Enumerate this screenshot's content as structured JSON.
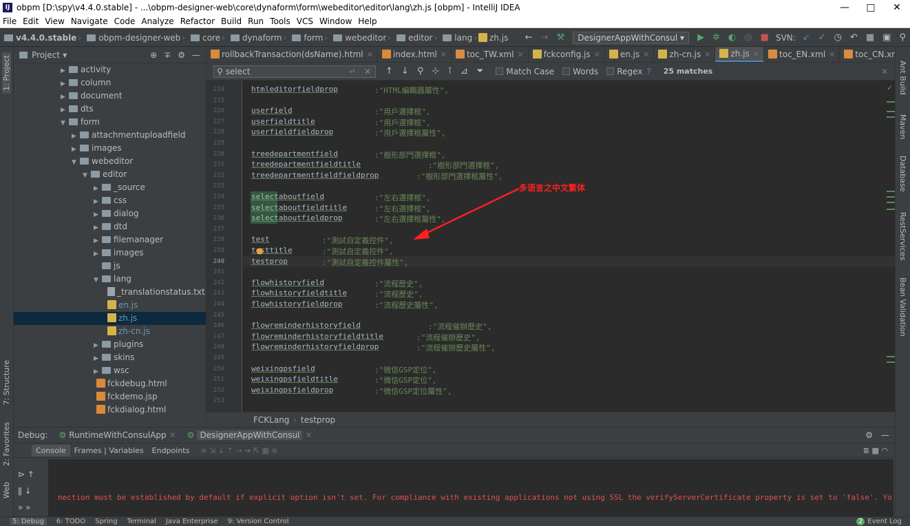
{
  "titlebar": {
    "title": "obpm [D:\\spy\\v4.4.0.stable] - ...\\obpm-designer-web\\core\\dynaform\\form\\webeditor\\editor\\lang\\zh.js [obpm] - IntelliJ IDEA",
    "minimize": "—",
    "maximize": "□",
    "close": "✕"
  },
  "menu": [
    "File",
    "Edit",
    "View",
    "Navigate",
    "Code",
    "Analyze",
    "Refactor",
    "Build",
    "Run",
    "Tools",
    "VCS",
    "Window",
    "Help"
  ],
  "navbar": {
    "crumbs": [
      "v4.4.0.stable",
      "obpm-designer-web",
      "core",
      "dynaform",
      "form",
      "webeditor",
      "editor",
      "lang",
      "zh.js"
    ],
    "run_config": "DesignerAppWithConsul",
    "svn_label": "SVN:"
  },
  "project": {
    "title": "Project",
    "tree": [
      {
        "label": "activity",
        "type": "folder",
        "indent": 0,
        "expanded": false
      },
      {
        "label": "column",
        "type": "folder",
        "indent": 0,
        "expanded": false
      },
      {
        "label": "document",
        "type": "folder",
        "indent": 0,
        "expanded": false
      },
      {
        "label": "dts",
        "type": "folder",
        "indent": 0,
        "expanded": false
      },
      {
        "label": "form",
        "type": "folder",
        "indent": 0,
        "expanded": true
      },
      {
        "label": "attachmentuploadfield",
        "type": "folder",
        "indent": 1,
        "expanded": false
      },
      {
        "label": "images",
        "type": "folder",
        "indent": 1,
        "expanded": false
      },
      {
        "label": "webeditor",
        "type": "folder",
        "indent": 1,
        "expanded": true
      },
      {
        "label": "editor",
        "type": "folder",
        "indent": 2,
        "expanded": true
      },
      {
        "label": "_source",
        "type": "folder",
        "indent": 3,
        "expanded": false
      },
      {
        "label": "css",
        "type": "folder",
        "indent": 3,
        "expanded": false
      },
      {
        "label": "dialog",
        "type": "folder",
        "indent": 3,
        "expanded": false
      },
      {
        "label": "dtd",
        "type": "folder",
        "indent": 3,
        "expanded": false
      },
      {
        "label": "filemanager",
        "type": "folder",
        "indent": 3,
        "expanded": false
      },
      {
        "label": "images",
        "type": "folder",
        "indent": 3,
        "expanded": false
      },
      {
        "label": "js",
        "type": "folder-leaf",
        "indent": 3,
        "expanded": false
      },
      {
        "label": "lang",
        "type": "folder",
        "indent": 3,
        "expanded": true
      },
      {
        "label": "_translationstatus.txt",
        "type": "txt",
        "indent": 4
      },
      {
        "label": "en.js",
        "type": "js",
        "indent": 4
      },
      {
        "label": "zh.js",
        "type": "js",
        "indent": 4,
        "selected": true
      },
      {
        "label": "zh-cn.js",
        "type": "js",
        "indent": 4
      },
      {
        "label": "plugins",
        "type": "folder",
        "indent": 3,
        "expanded": false
      },
      {
        "label": "skins",
        "type": "folder",
        "indent": 3,
        "expanded": false
      },
      {
        "label": "wsc",
        "type": "folder",
        "indent": 3,
        "expanded": false
      },
      {
        "label": "fckdebug.html",
        "type": "html",
        "indent": 3
      },
      {
        "label": "fckdemo.jsp",
        "type": "html",
        "indent": 3
      },
      {
        "label": "fckdialog.html",
        "type": "html",
        "indent": 3
      }
    ]
  },
  "tabs": [
    {
      "label": "rollbackTransaction(dsName).html",
      "icon": "html",
      "active": false
    },
    {
      "label": "index.html",
      "icon": "html",
      "active": false
    },
    {
      "label": "toc_TW.xml",
      "icon": "xml",
      "active": false
    },
    {
      "label": "fckconfig.js",
      "icon": "js",
      "active": false
    },
    {
      "label": "en.js",
      "icon": "js",
      "active": false
    },
    {
      "label": "zh-cn.js",
      "icon": "js",
      "active": false
    },
    {
      "label": "zh.js",
      "icon": "js",
      "active": true
    },
    {
      "label": "toc_EN.xml",
      "icon": "xml",
      "active": false
    },
    {
      "label": "toc_CN.xml",
      "icon": "xml",
      "active": false
    }
  ],
  "tabs_overflow": "≡ 1",
  "find": {
    "query": "select",
    "match_case": "Match Case",
    "words": "Words",
    "regex": "Regex",
    "help": "?",
    "matches": "25 matches"
  },
  "editor": {
    "lines": [
      {
        "n": "234",
        "key": "htmleditorfieldprop",
        "val": ":\"HTML編輯器屬性\","
      },
      {
        "n": "235",
        "key": "",
        "val": ""
      },
      {
        "n": "226",
        "key": "userfield",
        "val": ":\"用戶選擇框\","
      },
      {
        "n": "227",
        "key": "userfieldtitle",
        "val": ":\"用戶選擇框\","
      },
      {
        "n": "228",
        "key": "userfieldfieldprop",
        "val": ":\"用戶選擇框屬性\","
      },
      {
        "n": "229",
        "key": "",
        "val": ""
      },
      {
        "n": "230",
        "key": "treedepartmentfield",
        "val": ":\"樹形部門選擇框\","
      },
      {
        "n": "231",
        "key": "treedepartmentfieldtitle",
        "val": ":\"樹形部門選擇框\","
      },
      {
        "n": "232",
        "key": "treedepartmentfieldfieldprop",
        "val": ":\"樹形部門選擇框屬性\","
      },
      {
        "n": "233",
        "key": "",
        "val": ""
      },
      {
        "n": "234",
        "key": "selectaboutfield",
        "val": ":\"左右選擇框\","
      },
      {
        "n": "235",
        "key": "selectaboutfieldtitle",
        "val": ":\"左右選擇框\","
      },
      {
        "n": "236",
        "key": "selectaboutfieldprop",
        "val": ":\"左右選擇框屬性\","
      },
      {
        "n": "237",
        "key": "",
        "val": ""
      },
      {
        "n": "238",
        "key": "test",
        "val": ":\"測試自定義控件\","
      },
      {
        "n": "239",
        "key": "testtitle",
        "val": ":\"測試自定義控件\","
      },
      {
        "n": "240",
        "key": "testprop",
        "val": ":\"測試自定義控件屬性\","
      },
      {
        "n": "241",
        "key": "",
        "val": ""
      },
      {
        "n": "242",
        "key": "flowhistoryfield",
        "val": ":\"流程歷史\","
      },
      {
        "n": "243",
        "key": "flowhistoryfieldtitle",
        "val": ":\"流程歷史\","
      },
      {
        "n": "244",
        "key": "flowhistoryfieldprop",
        "val": ":\"流程歷史屬性\","
      },
      {
        "n": "245",
        "key": "",
        "val": ""
      },
      {
        "n": "246",
        "key": "flowreminderhistoryfield",
        "val": ":\"流程催辦歷史\","
      },
      {
        "n": "247",
        "key": "flowreminderhistoryfieldtitle",
        "val": ":\"流程催辦歷史\","
      },
      {
        "n": "248",
        "key": "flowreminderhistoryfieldprop",
        "val": ":\"流程催辦歷史屬性\","
      },
      {
        "n": "249",
        "key": "",
        "val": ""
      },
      {
        "n": "250",
        "key": "weixingpsfield",
        "val": ":\"微信GSP定位\","
      },
      {
        "n": "251",
        "key": "weixingpsfieldtitle",
        "val": ":\"微信GSP定位\","
      },
      {
        "n": "252",
        "key": "weixingpsfieldprop",
        "val": ":\"微信GSP定位屬性\","
      },
      {
        "n": "253",
        "key": "",
        "val": ""
      }
    ],
    "current_line": "240"
  },
  "annotation": "多语言之中文繁体",
  "breadcrumb": [
    "FCKLang",
    "testprop"
  ],
  "debug": {
    "label": "Debug:",
    "sessions": [
      "RuntimeWithConsulApp",
      "DesignerAppWithConsul"
    ],
    "tabs": [
      "Console",
      "Frames | Variables",
      "Endpoints"
    ],
    "console_line": "nection must be established by default if explicit option isn't set. For compliance with existing applications not using SSL the verifyServerCertificate property is set to 'false'. You need"
  },
  "statusbar": [
    "5: Debug",
    "6: TODO",
    "Spring",
    "Terminal",
    "Java Enterprise",
    "9: Version Control"
  ],
  "event_log": "Event Log",
  "event_count": "2",
  "left_tools": [
    "1: Project",
    "7: Structure",
    "2: Favorites",
    "Web"
  ],
  "right_tools": [
    "Ant Build",
    "Maven",
    "Database",
    "RestServices",
    "Bean Validation"
  ],
  "colors": {
    "accent": "#4a88c7",
    "annotation": "#ff2020",
    "string": "#6a8759",
    "error": "#e05252"
  }
}
